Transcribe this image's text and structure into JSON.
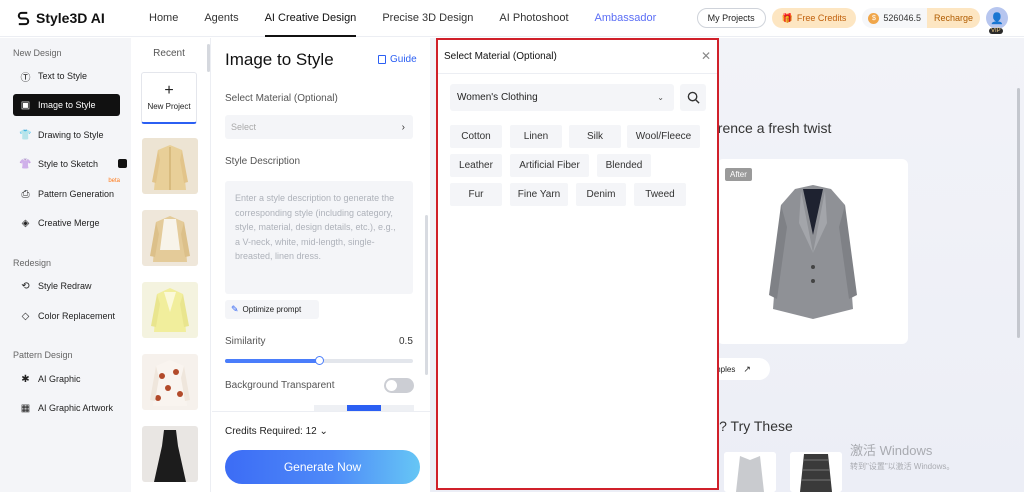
{
  "app": {
    "name": "Style3D AI"
  },
  "topnav": {
    "items": [
      "Home",
      "Agents",
      "AI Creative Design",
      "Precise 3D Design",
      "AI Photoshoot",
      "Ambassador"
    ],
    "active": "AI Creative Design",
    "my_projects": "My Projects",
    "free_credits": "Free Credits",
    "credits_balance": "526046.5",
    "recharge": "Recharge",
    "vip_badge": "VIP"
  },
  "sidebar": {
    "sections": [
      {
        "title": "New Design",
        "items": [
          "Text to Style",
          "Image to Style",
          "Drawing to Style",
          "Style to Sketch",
          "Pattern Generation",
          "Creative Merge"
        ]
      },
      {
        "title": "Redesign",
        "items": [
          "Style Redraw",
          "Color Replacement"
        ]
      },
      {
        "title": "Pattern Design",
        "items": [
          "AI Graphic",
          "AI Graphic Artwork"
        ]
      }
    ],
    "active_item": "Image to Style",
    "beta_label": "beta",
    "beta_item": "Pattern Generation"
  },
  "recent": {
    "title": "Recent",
    "new_project_label": "New Project"
  },
  "form": {
    "title": "Image to Style",
    "guide_label": "Guide",
    "material_label": "Select Material (Optional)",
    "material_placeholder": "Select",
    "description_label": "Style Description",
    "description_placeholder": "Enter a style description to generate the corresponding style (including category, style, material, design details, etc.), e.g., a V-neck, white, mid-length, single-breasted, linen dress.",
    "optimize_label": "Optimize prompt",
    "similarity_label": "Similarity",
    "similarity_value": 0.5,
    "similarity_display": "0.5",
    "background_label": "Background Transparent",
    "background_transparent": false,
    "credits_required": "Credits Required: 12",
    "generate_label": "Generate Now"
  },
  "content": {
    "hero_text": "erence a fresh twist",
    "after_tag": "After",
    "examples_label": "mples",
    "try_text": "l? Try These"
  },
  "watermark": {
    "line1": "激活 Windows",
    "line2": "转到\"设置\"以激活 Windows。"
  },
  "modal": {
    "title": "Select Material (Optional)",
    "category": "Women's Clothing",
    "materials": [
      "Cotton",
      "Linen",
      "Silk",
      "Wool/Fleece",
      "Leather",
      "Artificial Fiber",
      "Blended",
      "Fur",
      "Fine Yarn",
      "Denim",
      "Tweed"
    ]
  },
  "colors": {
    "accent": "#2b5ff3",
    "highlight_border": "#d0202a",
    "free_credits_bg": "#fde6c2"
  }
}
